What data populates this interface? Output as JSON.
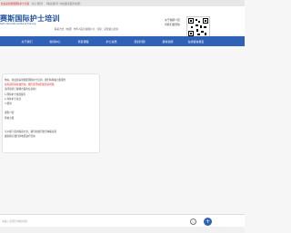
{
  "topbar": {
    "left_text": "欢迎来到赛斯国际护士培训",
    "middle_text": "【关于我们】",
    "right_text": "【联系我们】【在线报名服务电话】"
  },
  "header": {
    "logo_main": "赛斯国际护士培训",
    "logo_sub": "Seth International Nurse Training",
    "address_text": "联系方式（电话）中华人民共和国公共 · 注意：英伦语言培训",
    "right_line1": "关于赛斯介绍",
    "right_line2": "问我们发现情",
    "accent": "#2f62b7"
  },
  "nav": {
    "items": [
      "关于我们",
      "新闻中心",
      "项目课程",
      "护士资质",
      "培训问题",
      "报考指南",
      "在线留言报名"
    ]
  },
  "chat": {
    "lines": [
      {
        "text": "你好，欢迎您来到赛斯国际护士培训，我们将竭诚为您服务",
        "red": false
      },
      {
        "text": "如有疑问请在线咨询，我们会尽快回复您的问题",
        "red": true
      },
      {
        "text": "请问您想了解哪方面的信息呢？",
        "red": false
      },
      {
        "text": "1.国际护士执照报考",
        "red": false
      },
      {
        "text": "2.海外护士就业",
        "red": false
      },
      {
        "text": "3.费用",
        "red": false
      },
      {
        "text": "",
        "red": false
      },
      {
        "text": "课程介绍",
        "red": false
      },
      {
        "text": "师资力量",
        "red": false
      },
      {
        "text": "",
        "red": false
      },
      {
        "text": "",
        "red": false
      },
      {
        "text": "可以留下您的联系方式，我们的顾问会尽快联系您",
        "red": false
      },
      {
        "text": "或者拨打我们的电话进行咨询",
        "red": false
      }
    ]
  },
  "input": {
    "placeholder": "请输入您要咨询的问题",
    "emoji_icon": "smile-icon",
    "send_icon": "send-icon"
  }
}
